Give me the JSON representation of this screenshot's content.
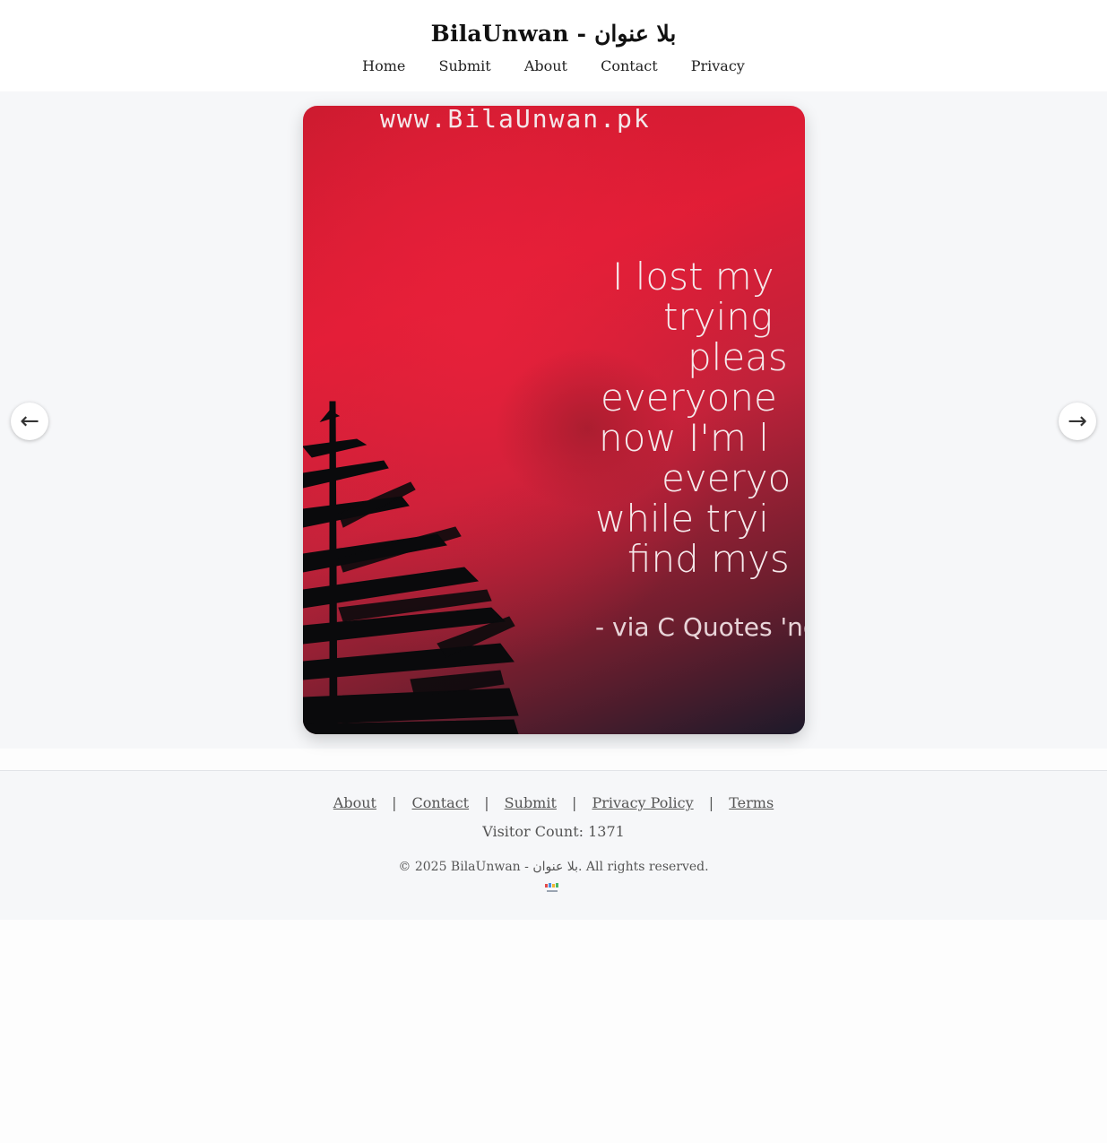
{
  "header": {
    "title": "BilaUnwan - بلا عنوان",
    "nav": [
      "Home",
      "Submit",
      "About",
      "Contact",
      "Privacy"
    ]
  },
  "slide": {
    "watermark": "www.BilaUnwan.pk",
    "quote_lines": [
      "I lost my",
      "trying",
      "pleas",
      "everyone",
      "now I'm l",
      "everyo",
      "while tryi",
      "find mys"
    ],
    "attribution": "- via C Quotes 'no",
    "colors": {
      "top": "#c91a2e",
      "middle": "#e11d36",
      "bottom": "#1d1a2a"
    }
  },
  "controls": {
    "prev_icon": "←",
    "next_icon": "→"
  },
  "footer": {
    "links": [
      "About",
      "Contact",
      "Submit",
      "Privacy Policy",
      "Terms"
    ],
    "separator": "|",
    "visitor_count": "Visitor Count: 1371",
    "copyright": "© 2025 BilaUnwan - بلا عنوان. All rights reserved."
  }
}
